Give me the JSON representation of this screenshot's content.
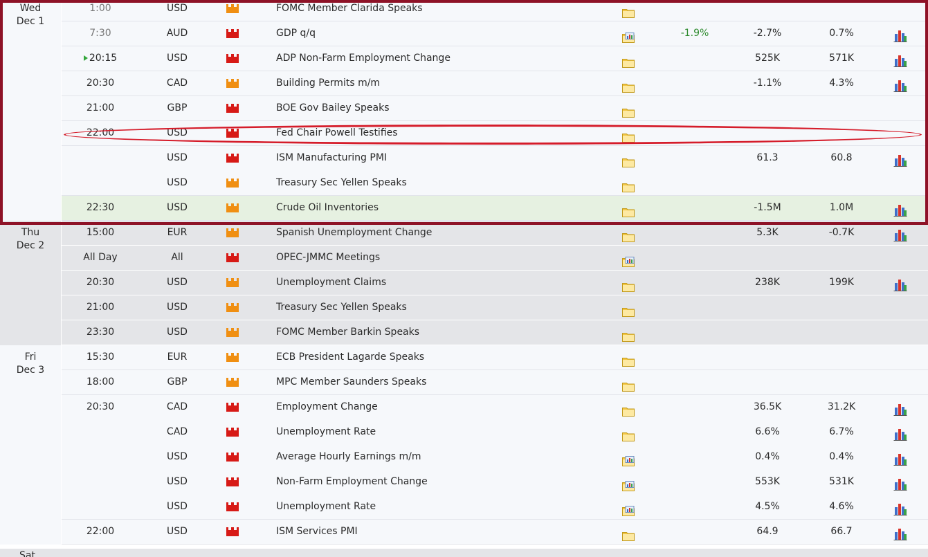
{
  "colors": {
    "high_impact": "#d71a16",
    "medium_impact": "#f08f12",
    "annotation_frame": "#8e1227",
    "annotation_ellipse": "#d51c2a",
    "actual_better": "#2e8b2e",
    "next_event_marker": "#33a63b"
  },
  "days": [
    {
      "weekday": "Wed",
      "date": "Dec 1",
      "shade": "white",
      "events": [
        {
          "time": "1:00",
          "time_past": true,
          "currency": "USD",
          "impact": "medium",
          "event": "FOMC Member Clarida Speaks",
          "detail_icon": "folder-icon",
          "actual": "",
          "forecast": "",
          "previous": "",
          "graph": false
        },
        {
          "time": "7:30",
          "time_past": true,
          "currency": "AUD",
          "impact": "high",
          "event": "GDP q/q",
          "detail_icon": "folder-chart-icon",
          "actual": "-1.9%",
          "actual_better": true,
          "forecast": "-2.7%",
          "previous": "0.7%",
          "graph": true
        },
        {
          "time": "20:15",
          "next_marker": true,
          "currency": "USD",
          "impact": "high",
          "event": "ADP Non-Farm Employment Change",
          "detail_icon": "folder-icon",
          "actual": "",
          "forecast": "525K",
          "previous": "571K",
          "graph": true
        },
        {
          "time": "20:30",
          "currency": "CAD",
          "impact": "medium",
          "event": "Building Permits m/m",
          "detail_icon": "folder-icon",
          "actual": "",
          "forecast": "-1.1%",
          "previous": "4.3%",
          "graph": true
        },
        {
          "time": "21:00",
          "currency": "GBP",
          "impact": "high",
          "event": "BOE Gov Bailey Speaks",
          "detail_icon": "folder-icon",
          "actual": "",
          "forecast": "",
          "previous": "",
          "graph": false
        },
        {
          "time": "22:00",
          "currency": "USD",
          "impact": "high",
          "event": "Fed Chair Powell Testifies",
          "detail_icon": "folder-icon",
          "actual": "",
          "forecast": "",
          "previous": "",
          "graph": false,
          "circled": true
        },
        {
          "time": "",
          "currency": "USD",
          "impact": "high",
          "event": "ISM Manufacturing PMI",
          "detail_icon": "folder-icon",
          "actual": "",
          "forecast": "61.3",
          "previous": "60.8",
          "graph": true,
          "no_separator": true
        },
        {
          "time": "",
          "currency": "USD",
          "impact": "medium",
          "event": "Treasury Sec Yellen Speaks",
          "detail_icon": "folder-icon",
          "actual": "",
          "forecast": "",
          "previous": "",
          "graph": false
        },
        {
          "time": "22:30",
          "currency": "USD",
          "impact": "medium",
          "event": "Crude Oil Inventories",
          "detail_icon": "folder-icon",
          "actual": "",
          "forecast": "-1.5M",
          "previous": "1.0M",
          "graph": true,
          "highlight": true
        }
      ]
    },
    {
      "weekday": "Thu",
      "date": "Dec 2",
      "shade": "grey",
      "events": [
        {
          "time": "15:00",
          "currency": "EUR",
          "impact": "medium",
          "event": "Spanish Unemployment Change",
          "detail_icon": "folder-icon",
          "actual": "",
          "forecast": "5.3K",
          "previous": "-0.7K",
          "graph": true
        },
        {
          "time": "All Day",
          "currency": "All",
          "impact": "high",
          "event": "OPEC-JMMC Meetings",
          "detail_icon": "folder-chart-icon",
          "actual": "",
          "forecast": "",
          "previous": "",
          "graph": false
        },
        {
          "time": "20:30",
          "currency": "USD",
          "impact": "medium",
          "event": "Unemployment Claims",
          "detail_icon": "folder-icon",
          "actual": "",
          "forecast": "238K",
          "previous": "199K",
          "graph": true
        },
        {
          "time": "21:00",
          "currency": "USD",
          "impact": "medium",
          "event": "Treasury Sec Yellen Speaks",
          "detail_icon": "folder-icon",
          "actual": "",
          "forecast": "",
          "previous": "",
          "graph": false
        },
        {
          "time": "23:30",
          "currency": "USD",
          "impact": "medium",
          "event": "FOMC Member Barkin Speaks",
          "detail_icon": "folder-icon",
          "actual": "",
          "forecast": "",
          "previous": "",
          "graph": false
        }
      ]
    },
    {
      "weekday": "Fri",
      "date": "Dec 3",
      "shade": "white",
      "events": [
        {
          "time": "15:30",
          "currency": "EUR",
          "impact": "medium",
          "event": "ECB President Lagarde Speaks",
          "detail_icon": "folder-icon",
          "actual": "",
          "forecast": "",
          "previous": "",
          "graph": false
        },
        {
          "time": "18:00",
          "currency": "GBP",
          "impact": "medium",
          "event": "MPC Member Saunders Speaks",
          "detail_icon": "folder-icon",
          "actual": "",
          "forecast": "",
          "previous": "",
          "graph": false
        },
        {
          "time": "20:30",
          "currency": "CAD",
          "impact": "high",
          "event": "Employment Change",
          "detail_icon": "folder-icon",
          "actual": "",
          "forecast": "36.5K",
          "previous": "31.2K",
          "graph": true,
          "no_separator": true
        },
        {
          "time": "",
          "currency": "CAD",
          "impact": "high",
          "event": "Unemployment Rate",
          "detail_icon": "folder-icon",
          "actual": "",
          "forecast": "6.6%",
          "previous": "6.7%",
          "graph": true,
          "no_separator": true
        },
        {
          "time": "",
          "currency": "USD",
          "impact": "high",
          "event": "Average Hourly Earnings m/m",
          "detail_icon": "folder-chart-icon",
          "actual": "",
          "forecast": "0.4%",
          "previous": "0.4%",
          "graph": true,
          "no_separator": true
        },
        {
          "time": "",
          "currency": "USD",
          "impact": "high",
          "event": "Non-Farm Employment Change",
          "detail_icon": "folder-chart-icon",
          "actual": "",
          "forecast": "553K",
          "previous": "531K",
          "graph": true,
          "no_separator": true
        },
        {
          "time": "",
          "currency": "USD",
          "impact": "high",
          "event": "Unemployment Rate",
          "detail_icon": "folder-chart-icon",
          "actual": "",
          "forecast": "4.5%",
          "previous": "4.6%",
          "graph": true
        },
        {
          "time": "22:00",
          "currency": "USD",
          "impact": "high",
          "event": "ISM Services PMI",
          "detail_icon": "folder-icon",
          "actual": "",
          "forecast": "64.9",
          "previous": "66.7",
          "graph": true
        }
      ]
    }
  ],
  "next_day_partial": {
    "weekday": "Sat"
  }
}
